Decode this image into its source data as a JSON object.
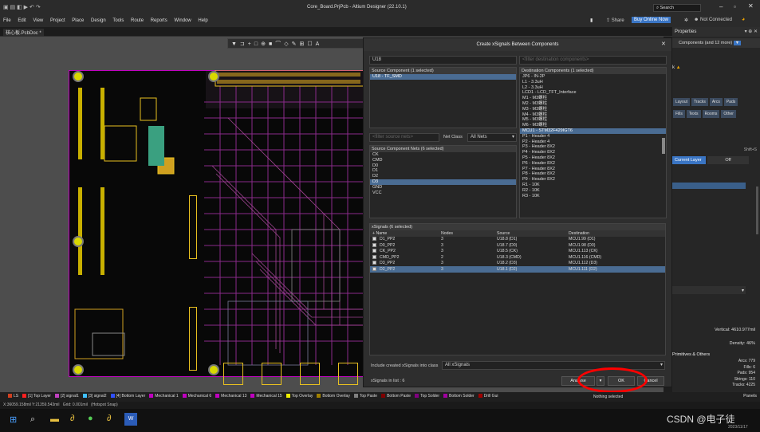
{
  "window": {
    "title": "Core_Board.PrjPcb - Altium Designer (22.10.1)",
    "search": "Search",
    "doc_tab": "核心板.PcbDoc *"
  },
  "menu": [
    "File",
    "Edit",
    "View",
    "Project",
    "Place",
    "Design",
    "Tools",
    "Route",
    "Reports",
    "Window",
    "Help"
  ],
  "top_right": {
    "share": "Share",
    "buy": "Buy Online Now",
    "connection": "Not Connected"
  },
  "dialog": {
    "title": "Create xSignals Between Components",
    "source_filter": "U18",
    "dest_filter_placeholder": "<filter destination components>",
    "source_header": "Source Component (1 selected)",
    "source_items": [
      "U18 - TF_SMD"
    ],
    "dest_header": "Destination Components (1 selected)",
    "dest_items": [
      "JP6 - IN-2P",
      "L1 - 3.3uH",
      "L2 - 3.3uH",
      "LCD1 - LCD_TFT_Interface",
      "M1 - M3螺柱",
      "M2 - M3螺柱",
      "M3 - M3螺柱",
      "M4 - M3螺柱",
      "M5 - M3螺柱",
      "M6 - M3螺柱",
      "MCU1 - STM32F429IGT6",
      "P1 - Header 4",
      "P2 - Header 4",
      "P3 - Header 8X2",
      "P4 - Header 8X2",
      "P5 - Header 8X2",
      "P6 - Header 8X2",
      "P7 - Header 8X2",
      "P8 - Header 8X2",
      "P9 - Header 8X2",
      "R1 - 10K",
      "R2 - 10K",
      "R3 - 10K"
    ],
    "dest_selected_index": 10,
    "nets_filter_placeholder": "<filter source nets>",
    "net_class_label": "Net Class",
    "net_class_value": "All Nets",
    "nets_header": "Source Component Nets (6 selected)",
    "nets": [
      "CK",
      "CMD",
      "D0",
      "D1",
      "D2",
      "D3",
      "GND",
      "VCC"
    ],
    "nets_selected_index": 5,
    "xsignals_header": "xSignals (6 selected)",
    "xsig_columns": [
      "Name",
      "Nodes",
      "Source",
      "Destination"
    ],
    "xsignals": [
      {
        "name": "D1_PP2",
        "nodes": "3",
        "source": "U18.8 (D1)",
        "dest": "MCU1.99 (D1)"
      },
      {
        "name": "D0_PP2",
        "nodes": "3",
        "source": "U18.7 (D0)",
        "dest": "MCU1.98 (D0)"
      },
      {
        "name": "CK_PP2",
        "nodes": "3",
        "source": "U18.5 (CK)",
        "dest": "MCU1.113 (CK)"
      },
      {
        "name": "CMD_PP2",
        "nodes": "2",
        "source": "U18.3 (CMD)",
        "dest": "MCU1.116 (CMD)"
      },
      {
        "name": "D3_PP2",
        "nodes": "3",
        "source": "U18.2 (D3)",
        "dest": "MCU1.112 (D3)"
      },
      {
        "name": "D2_PP2",
        "nodes": "3",
        "source": "U18.1 (D2)",
        "dest": "MCU1.111 (D2)"
      }
    ],
    "include_label": "Include created xSignals into class",
    "include_value": "All xSignals",
    "count_label": "xSignals in list : 6",
    "analyse": "Analyse",
    "ok": "OK",
    "cancel": "Cancel"
  },
  "props": {
    "title": "Properties",
    "components": "Components (and 12 more)",
    "tabs1": [
      "Layout",
      "Tracks",
      "Arcs",
      "Pads"
    ],
    "tabs2": [
      "Fills",
      "Texts",
      "Rooms",
      "Other"
    ],
    "shortcut": "Shift+S",
    "toggle": [
      "Current Layer",
      "Off"
    ],
    "vertical": "Vertical: 4610.977mil",
    "density": "Density: 46%",
    "prim_header": "Primitives & Others",
    "stats": [
      "Arcs: 779",
      "Fills: 6",
      "Pads: 954",
      "Strings: 110",
      "Tracks: 4225"
    ],
    "nothing": "Nothing selected",
    "panels": "Panels"
  },
  "layers": [
    {
      "name": "LS",
      "color": "#d04020"
    },
    {
      "name": "[1] Top Layer",
      "color": "#ff2020"
    },
    {
      "name": "[2] signal1",
      "color": "#c040c0"
    },
    {
      "name": "[3] signal2",
      "color": "#40c0ff"
    },
    {
      "name": "[4] Bottom Layer",
      "color": "#3050ff"
    },
    {
      "name": "Mechanical 1",
      "color": "#c000c0"
    },
    {
      "name": "Mechanical 6",
      "color": "#c000c0"
    },
    {
      "name": "Mechanical 13",
      "color": "#c000c0"
    },
    {
      "name": "Mechanical 15",
      "color": "#c000c0"
    },
    {
      "name": "Top Overlay",
      "color": "#f0f000"
    },
    {
      "name": "Bottom Overlay",
      "color": "#a08000"
    },
    {
      "name": "Top Paste",
      "color": "#808080"
    },
    {
      "name": "Bottom Paste",
      "color": "#800000"
    },
    {
      "name": "Top Solder",
      "color": "#800080"
    },
    {
      "name": "Bottom Solder",
      "color": "#a000a0"
    },
    {
      "name": "Drill Gui",
      "color": "#a00000"
    }
  ],
  "status": {
    "coords": "X:36059.158mil Y:21359.543mil",
    "grid": "Grid: 0.001mil",
    "snap": "(Hotspot Snap)"
  },
  "watermark": "CSDN @电子徒",
  "date": "2023/11/17",
  "colors": {
    "selection": "#4a6c93",
    "ok_circle": "#ff0000",
    "buy": "#3a75c4",
    "board": "#080808"
  }
}
